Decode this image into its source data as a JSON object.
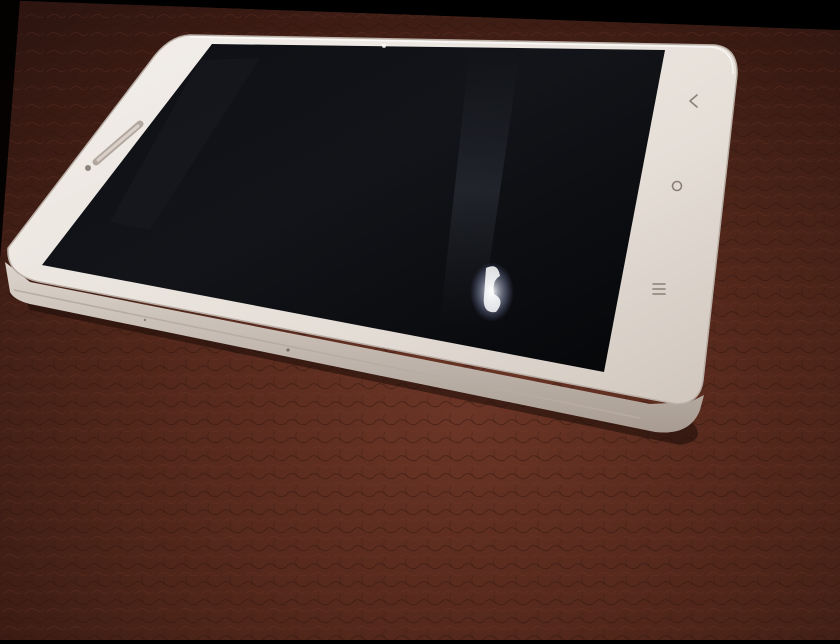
{
  "scene": {
    "subject": "smartphone",
    "surface": "brown leather"
  },
  "phone": {
    "buttons": {
      "back_icon": "chevron-left",
      "home_icon": "circle",
      "menu_icon": "three-lines"
    }
  },
  "colors": {
    "leather": "#4a2418",
    "leather_light": "#6b3526",
    "phone_body": "#e8e2dc",
    "phone_edge": "#c9c1b9",
    "screen": "#08090c",
    "background": "#000000"
  }
}
